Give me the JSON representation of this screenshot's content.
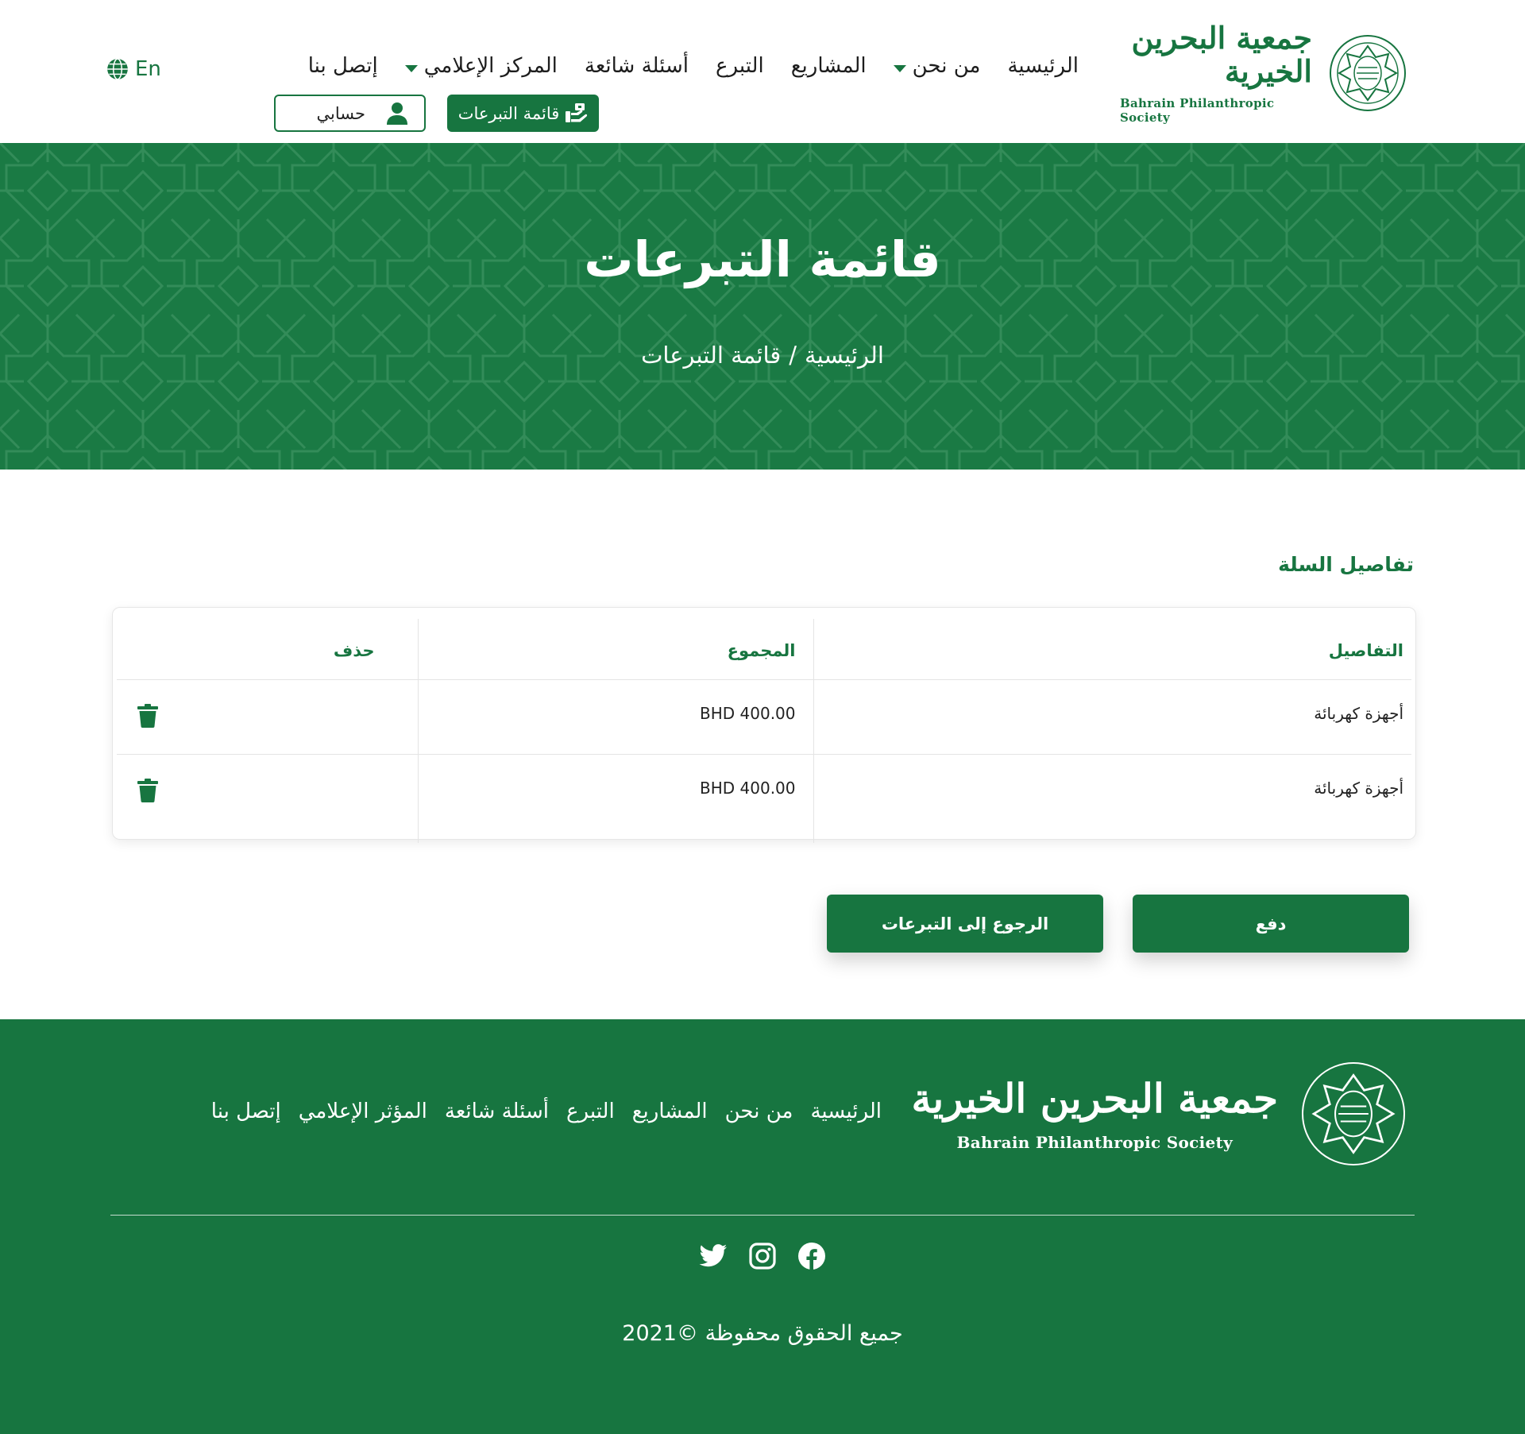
{
  "brand": {
    "name_ar": "جمعية البحرين الخيرية",
    "name_en": "Bahrain Philanthropic Society"
  },
  "header": {
    "nav": [
      {
        "label": "الرئيسية",
        "has_dropdown": false
      },
      {
        "label": "من نحن",
        "has_dropdown": true
      },
      {
        "label": "المشاريع",
        "has_dropdown": false
      },
      {
        "label": "التبرع",
        "has_dropdown": false
      },
      {
        "label": "أسئلة شائعة",
        "has_dropdown": false
      },
      {
        "label": "المركز الإعلامي",
        "has_dropdown": true
      },
      {
        "label": "إتصل بنا",
        "has_dropdown": false
      }
    ],
    "lang_label": "En",
    "cart_button": "قائمة التبرعات",
    "account_button": "حسابي"
  },
  "hero": {
    "title": "قائمة التبرعات",
    "breadcrumb": {
      "home": "الرئيسية",
      "separator": "/",
      "current": "قائمة التبرعات"
    }
  },
  "cart": {
    "title": "تفاصيل السلة",
    "columns": {
      "details": "التفاصيل",
      "total": "المجموع",
      "delete": "حذف"
    },
    "items": [
      {
        "details": "أجهزة كهربائة",
        "total": "BHD 400.00"
      },
      {
        "details": "أجهزة كهربائة",
        "total": "BHD 400.00"
      }
    ],
    "pay_button": "دفع",
    "back_button": "الرجوع إلى التبرعات"
  },
  "footer": {
    "nav": [
      "الرئيسية",
      "من نحن",
      "المشاريع",
      "التبرع",
      "أسئلة شائعة",
      "المؤثر الإعلامي",
      "إتصل بنا"
    ],
    "socials": [
      "twitter-icon",
      "instagram-icon",
      "facebook-icon"
    ],
    "copyright": "جميع الحقوق محفوظة ©2021"
  },
  "colors": {
    "primary_green": "#177540",
    "hero_green": "#1a7a44"
  }
}
